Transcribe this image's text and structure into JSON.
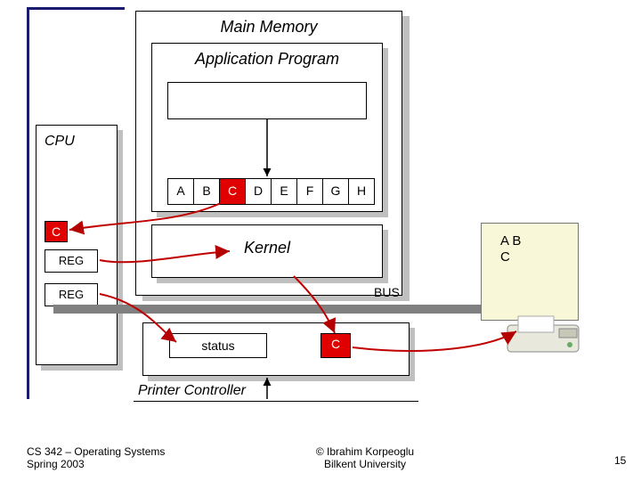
{
  "memory": {
    "title": "Main Memory",
    "app_label": "Application Program",
    "buffer_cells": [
      "A",
      "B",
      "C",
      "D",
      "E",
      "F",
      "G",
      "H"
    ],
    "highlight_index": 2,
    "kernel_label": "Kernel"
  },
  "cpu": {
    "label": "CPU",
    "c_cell": "C",
    "reg1": "REG",
    "reg2": "REG"
  },
  "bus_label": "BUS",
  "controller": {
    "title": "Printer Controller",
    "status_label": "status",
    "data_cell": "C"
  },
  "peripheral": {
    "buffer": "A  B",
    "buffer2": "C"
  },
  "footer": {
    "left1": "CS 342 – Operating Systems",
    "left2": "Spring 2003",
    "center1": "© Ibrahim Korpeoglu",
    "center2": "Bilkent University",
    "page": "15"
  }
}
